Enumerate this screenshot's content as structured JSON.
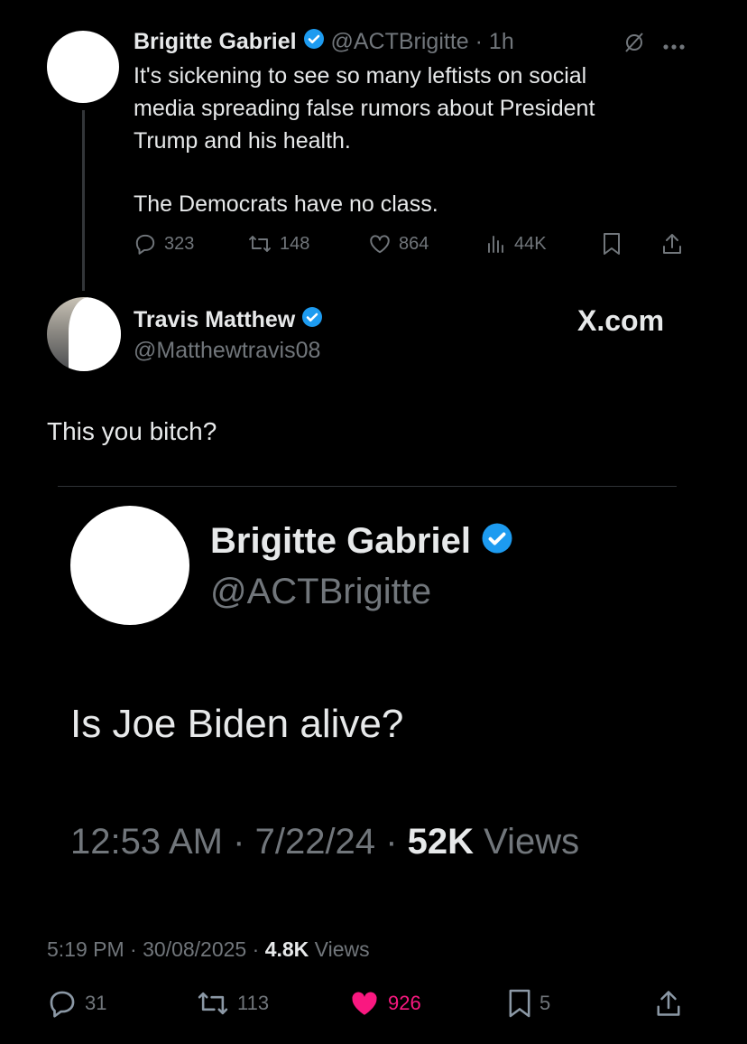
{
  "tweet1": {
    "author_name": "Brigitte Gabriel",
    "handle": "@ACTBrigitte",
    "dot": "·",
    "time": "1h",
    "more_icon": "more-horizontal-icon",
    "grok_icon": "grok-icon",
    "lines": [
      "It's sickening to see so many leftists on social",
      "media spreading false rumors about President",
      "Trump and his health."
    ],
    "line2": "The Democrats have no class.",
    "replies": "323",
    "reposts": "148",
    "likes": "864",
    "views": "44K"
  },
  "reply": {
    "author_name": "Travis Matthew",
    "handle": "@Matthewtravis08",
    "brand": "X.com",
    "text": "This you bitch?"
  },
  "embedded": {
    "author_name": "Brigitte Gabriel",
    "handle": "@ACTBrigitte",
    "text": "Is Joe Biden alive?",
    "time": "12:53 AM",
    "sep1": "·",
    "date": "7/22/24",
    "sep2": "·",
    "views_count": "52K",
    "views_label": "Views"
  },
  "meta": {
    "time": "5:19 PM",
    "sep1": "·",
    "date": "30/08/2025",
    "sep2": "·",
    "views_count": "4.8K",
    "views_label": "Views"
  },
  "actions": {
    "replies": "31",
    "reposts": "113",
    "likes": "926",
    "bookmarks": "5"
  },
  "colors": {
    "background": "#000000",
    "text": "#e7e9ea",
    "muted": "#71767b",
    "verified": "#1d9bf0",
    "like_active": "#f91880"
  }
}
